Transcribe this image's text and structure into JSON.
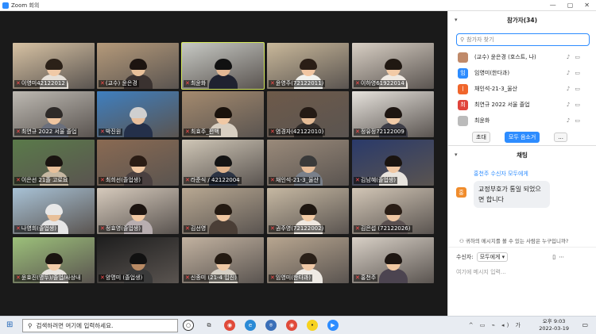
{
  "window": {
    "title": "Zoom 회의",
    "controls": [
      "—",
      "▢",
      "✕"
    ]
  },
  "tiles": [
    {
      "name": "이영미42122012",
      "bg": "#d7c2a3",
      "hair": "#2b2118",
      "skin": "#f0c9a6",
      "shirt": "#e6e0d8"
    },
    {
      "name": "(교수) 윤은경",
      "bg": "#b59a7a",
      "hair": "#1c1410",
      "skin": "#e9c19a",
      "shirt": "#3a3230"
    },
    {
      "name": "최윤화",
      "bg": "#c7c9c4",
      "hair": "#111111",
      "skin": "#e3b894",
      "shirt": "#1f2230",
      "active": true
    },
    {
      "name": "윤영주(72122011)",
      "bg": "#c9b89a",
      "hair": "#2a1e16",
      "skin": "#f1c6a2",
      "shirt": "#f2f2ee"
    },
    {
      "name": "이하영61922014",
      "bg": "#d8cfc4",
      "hair": "#201812",
      "skin": "#f2caa6",
      "shirt": "#efe9e2"
    },
    {
      "name": "최연규 2022 서울 졸업",
      "bg": "#bdb9b2",
      "hair": "#2e2a28",
      "skin": "#efc5a0",
      "shirt": "#6a6f7c"
    },
    {
      "name": "박진원",
      "bg": "#3f7fbf",
      "hair": "#cfcfcf",
      "skin": "#e8bf9c",
      "shirt": "#24304a"
    },
    {
      "name": "최효주_편백",
      "bg": "#a48a6e",
      "hair": "#1a120c",
      "skin": "#f0c8a4",
      "shirt": "#d8cfc2"
    },
    {
      "name": "염경자(42122010)",
      "bg": "#6e5a4a",
      "hair": "#241a14",
      "skin": "#e6bc96",
      "shirt": "#2f2a28"
    },
    {
      "name": "정유정72122009",
      "bg": "#e6e2dc",
      "hair": "#1e1612",
      "skin": "#f2cba8",
      "shirt": "#3c3c46"
    },
    {
      "name": "이은선 21졸 고로요",
      "bg": "#5a7a4a",
      "hair": "#1a1410",
      "skin": "#e8c09a",
      "shirt": "#c6b8a2"
    },
    {
      "name": "최희선(졸업생)",
      "bg": "#8a6a52",
      "hair": "#2a1c14",
      "skin": "#efc7a2",
      "shirt": "#4a4040"
    },
    {
      "name": "라준식 / 42122004",
      "bg": "#cfc6b6",
      "hair": "#141414",
      "skin": "#dfb38c",
      "shirt": "#2c3444"
    },
    {
      "name": "채인석-21-3_울산",
      "bg": "#9a8a7a",
      "hair": "#3a3a3a",
      "skin": "#e6bc98",
      "shirt": "#7a808a"
    },
    {
      "name": "김남혜(졸업생)",
      "bg": "#2a3a6a",
      "hair": "#1a1410",
      "skin": "#f0c8a4",
      "shirt": "#e8e4de"
    },
    {
      "name": "나영희(졸업생)",
      "bg": "#a8c2d6",
      "hair": "#e8e8e8",
      "skin": "#e8c09a",
      "shirt": "#e6e6e6"
    },
    {
      "name": "정효영(졸업생)",
      "bg": "#d6cabc",
      "hair": "#1c1410",
      "skin": "#f0c8a2",
      "shirt": "#b8aeb0"
    },
    {
      "name": "김선영",
      "bg": "#b8a892",
      "hair": "#241a12",
      "skin": "#efc6a0",
      "shirt": "#4a3e36"
    },
    {
      "name": "권주영(72122002)",
      "bg": "#c6b8a2",
      "hair": "#1e1610",
      "skin": "#f2caa4",
      "shirt": "#efe8e0"
    },
    {
      "name": "김은섭 (72122026)",
      "bg": "#d2c6b6",
      "hair": "#2a1e16",
      "skin": "#efc6a2",
      "shirt": "#5a5050"
    },
    {
      "name": "윤효진(명두)/졸업/사상내",
      "bg": "#9cc07a",
      "hair": "#1a1410",
      "skin": "#f2cca8",
      "shirt": "#e8e4de"
    },
    {
      "name": "양명미 (졸업생)",
      "bg": "#1e1e1e",
      "hair": "#111111",
      "skin": "#b88a64",
      "shirt": "#3a3a3a"
    },
    {
      "name": "신종미 (21-4 입진)",
      "bg": "#c2b2a0",
      "hair": "#241a12",
      "skin": "#efc8a4",
      "shirt": "#d6d0c6"
    },
    {
      "name": "임영미(한다과)",
      "bg": "#b8a690",
      "hair": "#2a2018",
      "skin": "#f0c9a6",
      "shirt": "#eeeae4"
    },
    {
      "name": "홍천주",
      "bg": "#d8d0c6",
      "hair": "#1e1612",
      "skin": "#f0c8a2",
      "shirt": "#4c4450"
    }
  ],
  "participants_panel": {
    "title": "참가자(34)",
    "search_placeholder": "참가자 찾기",
    "people": [
      {
        "initial": "",
        "name": "(교수) 윤은경 (호스트, 나)",
        "color": "#c08a6a"
      },
      {
        "initial": "임",
        "name": "임영미(한다과)",
        "color": "#2d8cff"
      },
      {
        "initial": "ㅣ",
        "name": "채인석-21-3_울산",
        "color": "#f0662c"
      },
      {
        "initial": "최",
        "name": "최연규 2022 서울 졸업",
        "color": "#e0443c"
      },
      {
        "initial": "",
        "name": "최윤화",
        "color": "#bbbbbb"
      }
    ],
    "invite_label": "초대",
    "mute_all_label": "모두 음소거",
    "more_label": "..."
  },
  "chat_panel": {
    "title": "채팅",
    "sender_line": "홍천주 수신자 모두에게",
    "avatar_initial": "홍",
    "message": "교정부호가 통일 되었으면 합니다",
    "notice": "귀하의 메시지를 볼 수 있는 사람은 누구입니까?",
    "recipient_label": "수신자:",
    "recipient_value": "모두에게",
    "input_placeholder": "여기에 메시지 입력..."
  },
  "taskbar": {
    "search_placeholder": "검색하려면 여기에 입력하세요.",
    "time": "오후 9:03",
    "date": "2022-03-19",
    "lang": "가"
  }
}
